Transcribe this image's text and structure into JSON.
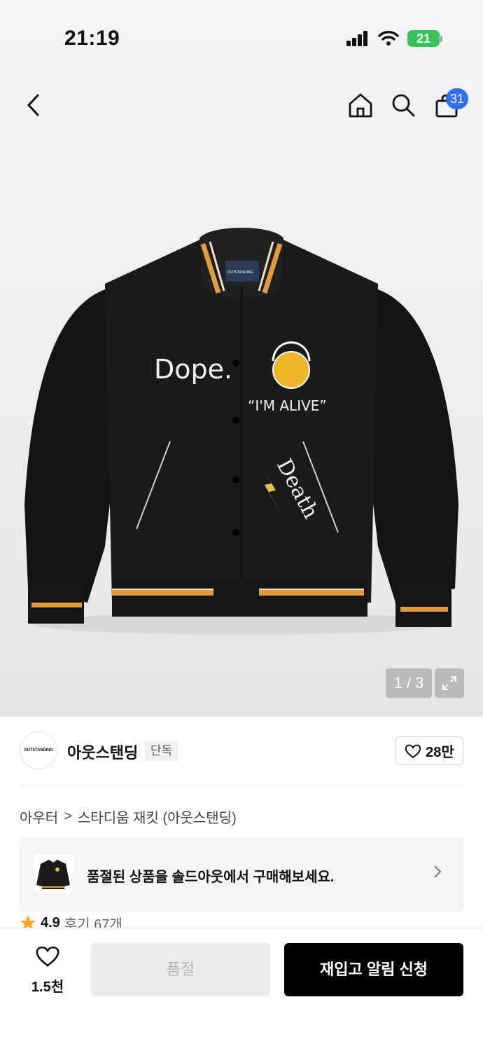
{
  "status_bar": {
    "time": "21:19",
    "battery": "21"
  },
  "nav": {
    "cart_count": "31",
    "icons": [
      "back-arrow-icon",
      "home-icon",
      "search-icon",
      "shopping-bag-icon"
    ]
  },
  "product_image": {
    "pager": "1 / 3",
    "jacket_texts": {
      "dope": "Dope.",
      "alive": "“I'M ALIVE”",
      "death": "Death",
      "label": "OUTSTANDING"
    }
  },
  "brand": {
    "logo_text": "OUTSTANDING",
    "name": "아웃스탠딩",
    "tag": "단독",
    "likes": "28만"
  },
  "breadcrumb": {
    "category": "아우터",
    "separator": ">",
    "product": "스타디움 재킷 (아웃스탠딩)"
  },
  "soldout_banner": {
    "text": "품절된 상품을 솔드아웃에서 구매해보세요."
  },
  "rating": {
    "score": "4.9",
    "reviews": "후기 67개",
    "star_color": "#f5a623"
  },
  "bottom_bar": {
    "wish_count": "1.5천",
    "soldout_label": "품절",
    "restock_label": "재입고 알림 신청"
  }
}
